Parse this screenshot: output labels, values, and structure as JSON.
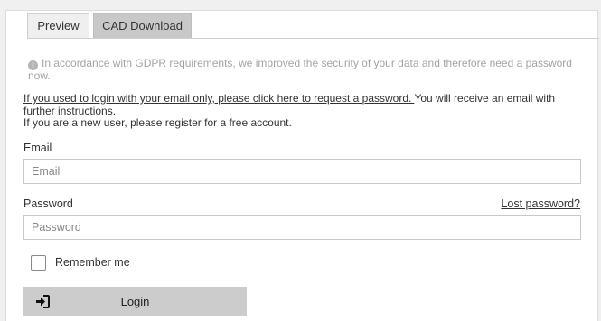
{
  "tabs": [
    {
      "label": "Preview",
      "active": false
    },
    {
      "label": "CAD Download",
      "active": true
    }
  ],
  "notice": {
    "icon": "info-icon",
    "text": "In accordance with GDPR requirements, we improved the security of your data and therefore need a password now."
  },
  "message": {
    "link_text": "If you used to login with your email only, please click here to request a password. ",
    "after_link": "You will receive an email with further instructions.",
    "new_user": "If you are a new user, please register for a free account."
  },
  "form": {
    "email_label": "Email",
    "email_placeholder": "Email",
    "email_value": "",
    "password_label": "Password",
    "password_placeholder": "Password",
    "password_value": "",
    "lost_password": "Lost password?",
    "remember_label": "Remember me",
    "remember_checked": false,
    "login_label": "Login",
    "login_icon": "sign-in-icon"
  },
  "colors": {
    "active_tab": "#c8c8c8",
    "inactive_tab": "#efefef",
    "login_button": "#cccccc",
    "notice_text": "#a4a4a4"
  }
}
